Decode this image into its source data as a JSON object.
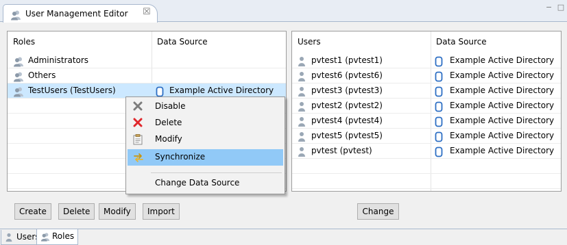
{
  "editor_tab": {
    "title": "User Management Editor",
    "close_glyph": "☒",
    "view_controls": "− □"
  },
  "roles_table": {
    "headers": [
      "Roles",
      "Data Source"
    ],
    "rows": [
      {
        "name": "Administrators",
        "source": ""
      },
      {
        "name": "Others",
        "source": ""
      },
      {
        "name": "TestUsers (TestUsers)",
        "source": "Example Active Directory",
        "selected": true
      }
    ]
  },
  "users_table": {
    "headers": [
      "Users",
      "Data Source"
    ],
    "rows": [
      {
        "name": "pvtest1 (pvtest1)",
        "source": "Example Active Directory"
      },
      {
        "name": "pvtest6 (pvtest6)",
        "source": "Example Active Directory"
      },
      {
        "name": "pvtest3 (pvtest3)",
        "source": "Example Active Directory"
      },
      {
        "name": "pvtest2 (pvtest2)",
        "source": "Example Active Directory"
      },
      {
        "name": "pvtest4 (pvtest4)",
        "source": "Example Active Directory"
      },
      {
        "name": "pvtest5 (pvtest5)",
        "source": "Example Active Directory"
      },
      {
        "name": "pvtest (pvtest)",
        "source": "Example Active Directory"
      }
    ]
  },
  "roles_buttons": [
    "Create",
    "Delete",
    "Modify",
    "Import"
  ],
  "users_buttons": [
    "Change"
  ],
  "context_menu": {
    "items": [
      {
        "label": "Disable",
        "icon": "disable-icon"
      },
      {
        "label": "Delete",
        "icon": "delete-icon"
      },
      {
        "label": "Modify",
        "icon": "modify-icon"
      },
      {
        "label": "Synchronize",
        "icon": "synchronize-icon",
        "highlighted": true
      },
      {
        "label": "Change Data Source",
        "icon": ""
      }
    ]
  },
  "bottom_tabs": [
    "Users",
    "Roles"
  ],
  "colors": {
    "selection": "#cce8ff",
    "menu_highlight": "#91c9f7",
    "delete_red": "#e0262b",
    "db_blue": "#2d6fc4"
  }
}
